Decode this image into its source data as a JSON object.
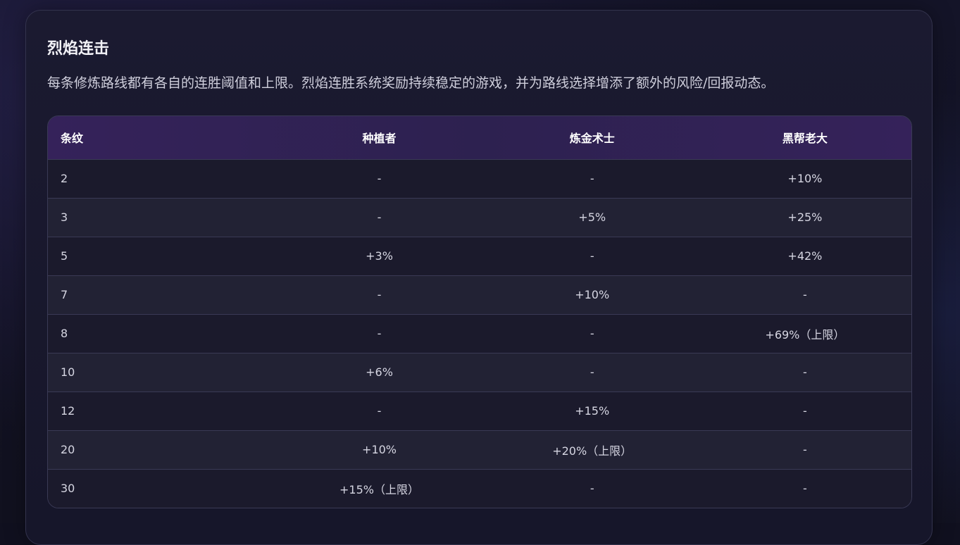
{
  "section": {
    "title": "烈焰连击",
    "description": "每条修炼路线都有各自的连胜阈值和上限。烈焰连胜系统奖励持续稳定的游戏，并为路线选择增添了额外的风险/回报动态。"
  },
  "table": {
    "headers": [
      "条纹",
      "种植者",
      "炼金术士",
      "黑帮老大"
    ],
    "rows": [
      [
        "2",
        "-",
        "-",
        "+10%"
      ],
      [
        "3",
        "-",
        "+5%",
        "+25%"
      ],
      [
        "5",
        "+3%",
        "-",
        "+42%"
      ],
      [
        "7",
        "-",
        "+10%",
        "-"
      ],
      [
        "8",
        "-",
        "-",
        "+69%（上限）"
      ],
      [
        "10",
        "+6%",
        "-",
        "-"
      ],
      [
        "12",
        "-",
        "+15%",
        "-"
      ],
      [
        "20",
        "+10%",
        "+20%（上限）",
        "-"
      ],
      [
        "30",
        "+15%（上限）",
        "-",
        "-"
      ]
    ]
  },
  "colors": {
    "header_accent": "#35225a",
    "card_background": "#1b1a30",
    "border": "#3a3a55"
  }
}
